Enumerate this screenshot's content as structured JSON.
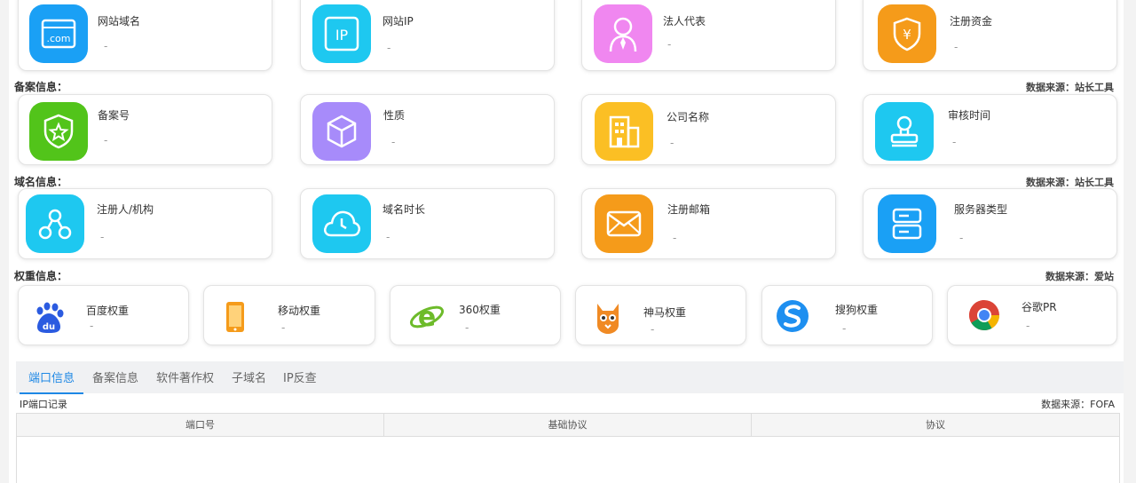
{
  "sections": {
    "beian": {
      "title": "备案信息：",
      "source": "数据来源：站长工具"
    },
    "domain": {
      "title": "域名信息：",
      "source": "数据来源：站长工具"
    },
    "weight": {
      "title": "权重信息：",
      "source": "数据来源：爱站"
    }
  },
  "row1": [
    {
      "title": "网站域名",
      "value": "-",
      "color": "#1aa0f5",
      "icon": "com-icon",
      "icon_text": ".com"
    },
    {
      "title": "网站IP",
      "value": "-",
      "color": "#1ec8f0",
      "icon": "ip-icon",
      "icon_text": "IP"
    },
    {
      "title": "法人代表",
      "value": "-",
      "color": "#f087f0",
      "icon": "person-icon"
    },
    {
      "title": "注册资金",
      "value": "-",
      "color": "#f59b1a",
      "icon": "yen-shield-icon",
      "icon_text": "¥"
    }
  ],
  "row2": [
    {
      "title": "备案号",
      "value": "-",
      "color": "#52c41a",
      "icon": "shield-star-icon"
    },
    {
      "title": "性质",
      "value": "-",
      "color": "#a78bfa",
      "icon": "cube-icon"
    },
    {
      "title": "公司名称",
      "value": "-",
      "color": "#fbbf24",
      "icon": "building-icon"
    },
    {
      "title": "审核时间",
      "value": "-",
      "color": "#1ec8f0",
      "icon": "stamp-icon"
    }
  ],
  "row3": [
    {
      "title": "注册人/机构",
      "value": "-",
      "color": "#1ec8f0",
      "icon": "network-icon"
    },
    {
      "title": "域名时长",
      "value": "-",
      "color": "#1ec8f0",
      "icon": "clock-cloud-icon"
    },
    {
      "title": "注册邮箱",
      "value": "-",
      "color": "#f59b1a",
      "icon": "mail-icon"
    },
    {
      "title": "服务器类型",
      "value": "-",
      "color": "#1aa0f5",
      "icon": "server-icon"
    }
  ],
  "row4": [
    {
      "title": "百度权重",
      "value": "-",
      "icon": "baidu-icon",
      "icon_text": "du"
    },
    {
      "title": "移动权重",
      "value": "-",
      "icon": "mobile-icon"
    },
    {
      "title": "360权重",
      "value": "-",
      "icon": "ie-360-icon",
      "icon_text": "e"
    },
    {
      "title": "神马权重",
      "value": "-",
      "icon": "shenma-icon"
    },
    {
      "title": "搜狗权重",
      "value": "-",
      "icon": "sogou-icon"
    },
    {
      "title": "谷歌PR",
      "value": "-",
      "icon": "chrome-icon"
    }
  ],
  "tabs": [
    "端口信息",
    "备案信息",
    "软件著作权",
    "子域名",
    "IP反查"
  ],
  "active_tab": 0,
  "port_section": {
    "label": "IP端口记录",
    "source": "数据来源：FOFA"
  },
  "table": {
    "headers": [
      "端口号",
      "基础协议",
      "协议"
    ]
  }
}
